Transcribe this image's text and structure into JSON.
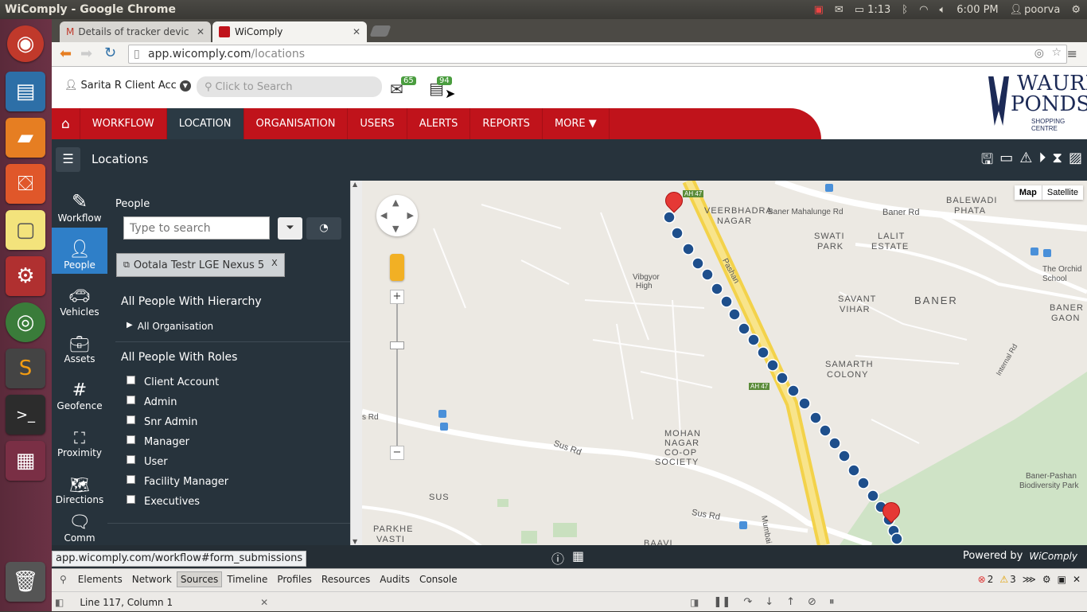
{
  "os": {
    "window_title": "WiComply - Google Chrome",
    "battery": "1:13",
    "clock": "6:00 PM",
    "user": "poorva"
  },
  "browser": {
    "tabs": [
      {
        "label": "Details of tracker device"
      },
      {
        "label": "WiComply"
      }
    ],
    "url_host": "app.wicomply.com",
    "url_path": "/locations"
  },
  "header": {
    "account": "Sarita R Client Acc",
    "search_placeholder": "Click to Search",
    "mail_count": "65",
    "task_count": "94",
    "logo_line1": "WAURN",
    "logo_line2": "PONDS",
    "logo_line3": "SHOPPING CENTRE"
  },
  "nav": {
    "items": [
      "WORKFLOW",
      "LOCATION",
      "ORGANISATION",
      "USERS",
      "ALERTS",
      "REPORTS",
      "MORE ▼"
    ]
  },
  "section": {
    "title": "Locations"
  },
  "rail": {
    "items": [
      "Workflow",
      "People",
      "Vehicles",
      "Assets",
      "Geofence",
      "Proximity",
      "Directions",
      "Comm"
    ]
  },
  "panel": {
    "heading": "People",
    "search_placeholder": "Type to search",
    "selected_chip": "Ootala Testr LGE Nexus 5",
    "chip_close": "X",
    "hierarchy_title": "All People With Hierarchy",
    "hierarchy_item": "All Organisation",
    "roles_title": "All People With Roles",
    "roles": [
      "Client Account",
      "Admin",
      "Snr Admin",
      "Manager",
      "User",
      "Facility Manager",
      "Executives"
    ]
  },
  "map": {
    "type_buttons": [
      "Map",
      "Satellite"
    ],
    "labels": {
      "baner_rd": "Baner Rd",
      "baner_mahalunge": "Baner Mahalunge Rd",
      "veerbhadra": "VEERBHADRA",
      "nagar": "NAGAR",
      "swati": "SWATI",
      "park": "PARK",
      "lalit": "LALIT",
      "estate": "ESTATE",
      "balewadi": "BALEWADI",
      "phata": "PHATA",
      "orchid": "The Orchid",
      "school": "School",
      "vibgyor": "Vibgyor",
      "high": "High",
      "pashan": "Pashan",
      "savant": "SAVANT",
      "vihar": "VIHAR",
      "baner": "BANER",
      "baner_gaon": "BANER",
      "gaon": "GAON",
      "samarth": "SAMARTH",
      "colony": "COLONY",
      "mohan": "MOHAN",
      "nagar2": "NAGAR",
      "coop": "CO-OP",
      "society": "SOCIETY",
      "sus_rd": "Sus Rd",
      "sus_rd2": "Sus Rd",
      "sus": "SUS",
      "parkhe": "PARKHE",
      "vasti": "VASTI",
      "baavi": "BAAVI",
      "mumbai_pune": "Mumbai Pune",
      "ah47a": "AH 47",
      "ah47b": "AH 47",
      "biodiv1": "Baner-Pashan",
      "biodiv2": "Biodiversity Park",
      "internal": "Internal Rd",
      "s_rd": "s Rd"
    }
  },
  "status": {
    "link": "app.wicomply.com/workflow#form_submissions",
    "powered": "Powered by",
    "brand": "WiComply"
  },
  "devtools": {
    "tabs": [
      "Elements",
      "Network",
      "Sources",
      "Timeline",
      "Profiles",
      "Resources",
      "Audits",
      "Console"
    ],
    "errors": "2",
    "warnings": "3",
    "cursor_pos": "Line 117, Column 1"
  }
}
